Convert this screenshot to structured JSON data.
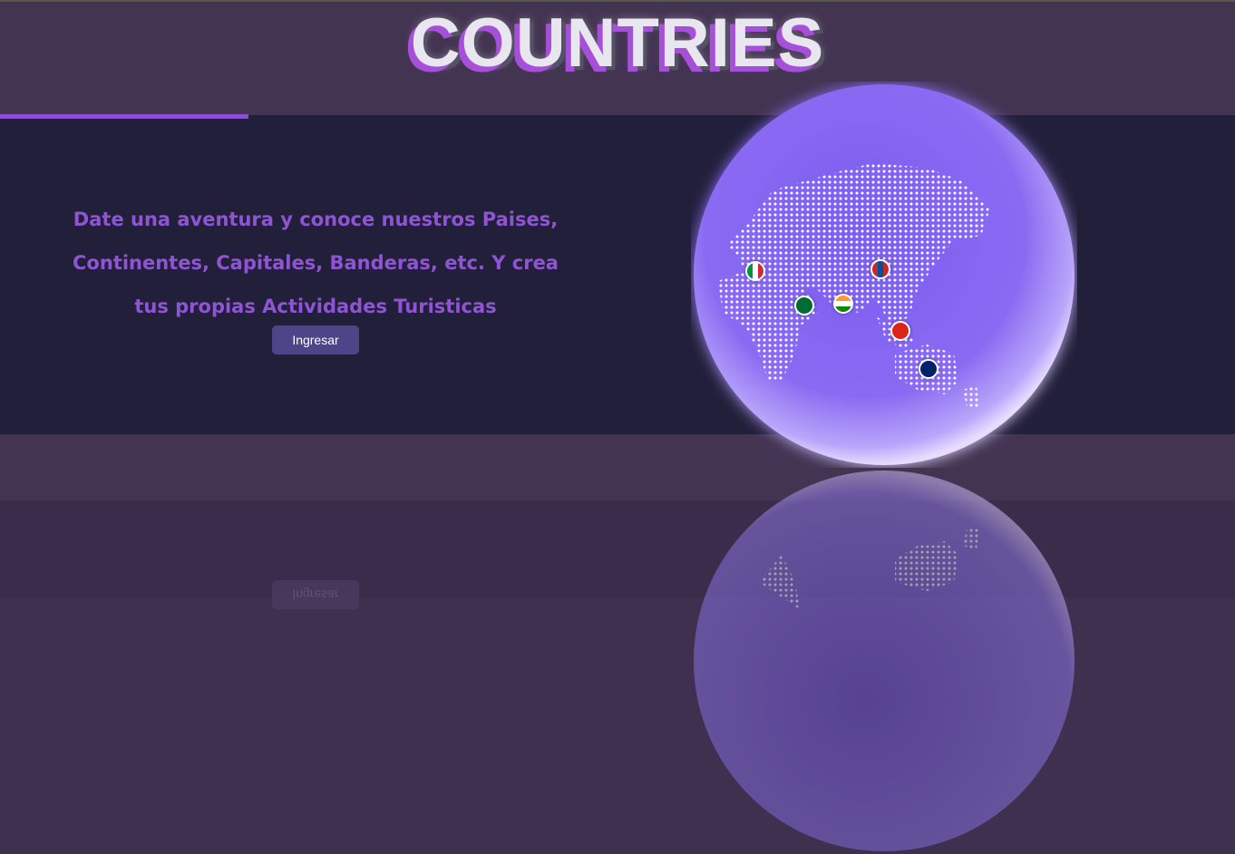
{
  "header": {
    "title": "COUNTRIES"
  },
  "hero": {
    "text": "Date una aventura y conoce nuestros Paises, Continentes, Capitales, Banderas, etc. Y crea tus propias Actividades Turisticas",
    "button_label": "Ingresar"
  },
  "globe": {
    "flags": [
      "italy-flag",
      "saudi-arabia-flag",
      "india-flag",
      "mongolia-flag",
      "vietnam-flag",
      "australia-flag"
    ]
  },
  "colors": {
    "accent": "#8a4fd0",
    "text_purple": "#8f54d4",
    "button": "#4c4688",
    "globe": "#8a6ef0"
  }
}
